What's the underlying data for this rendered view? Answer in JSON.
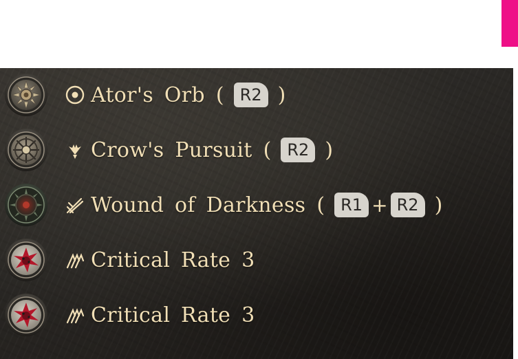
{
  "colors": {
    "accent_bar": "#ee0f87",
    "label_text": "#f1dfb6",
    "button_bg": "#d7d4cd",
    "button_text": "#2b2926",
    "panel_bg": "#2a2825"
  },
  "skills": [
    {
      "medal_icon": "gear-sun-medal-icon",
      "type_icon": "orb-target-icon",
      "label": "Ator's Orb",
      "paren_open": "(",
      "paren_close": ")",
      "buttons": [
        "R2"
      ]
    },
    {
      "medal_icon": "wheel-medal-icon",
      "type_icon": "crow-icon",
      "label": "Crow's Pursuit",
      "paren_open": "(",
      "paren_close": ")",
      "buttons": [
        "R2"
      ]
    },
    {
      "medal_icon": "spiked-orb-medal-icon",
      "type_icon": "crossed-blades-icon",
      "label": "Wound of Darkness",
      "paren_open": "(",
      "paren_close": ")",
      "buttons": [
        "R1",
        "R2"
      ],
      "plus": "+"
    },
    {
      "medal_icon": "blood-burst-medal-icon",
      "type_icon": "claw-slash-icon",
      "label": "Critical Rate 3"
    },
    {
      "medal_icon": "blood-burst-medal-icon",
      "type_icon": "claw-slash-icon",
      "label": "Critical Rate 3"
    }
  ]
}
